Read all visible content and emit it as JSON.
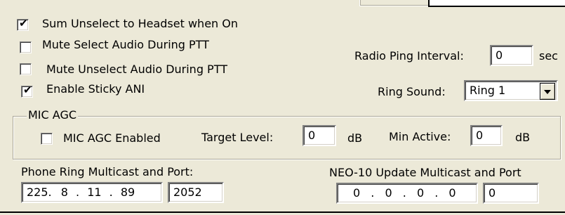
{
  "options": {
    "sum_unselect": {
      "label": "Sum Unselect to Headset when On",
      "checked": true
    },
    "mute_select": {
      "label": "Mute Select Audio During PTT",
      "checked": false
    },
    "mute_unselect": {
      "label": "Mute Unselect Audio During PTT",
      "checked": false
    },
    "sticky_ani": {
      "label": "Enable Sticky ANI",
      "checked": true
    }
  },
  "radio_ping": {
    "label": "Radio Ping Interval:",
    "value": "0",
    "unit": "sec"
  },
  "ring_sound": {
    "label": "Ring Sound:",
    "value": "Ring 1"
  },
  "mic_agc": {
    "title": "MIC AGC",
    "enabled": {
      "label": "MIC AGC Enabled",
      "checked": false
    },
    "target_level": {
      "label": "Target Level:",
      "value": "0",
      "unit": "dB"
    },
    "min_active": {
      "label": "Min Active:",
      "value": "0",
      "unit": "dB"
    }
  },
  "phone_ring": {
    "label": "Phone Ring Multicast and Port:",
    "ip": [
      "225.",
      "8",
      ".",
      "11",
      ".",
      "89"
    ],
    "port": "2052"
  },
  "neo10": {
    "label": "NEO-10 Update Multicast and Port",
    "ip": [
      "0",
      ".",
      "0",
      ".",
      "0",
      ".",
      "0"
    ],
    "port": "0"
  }
}
